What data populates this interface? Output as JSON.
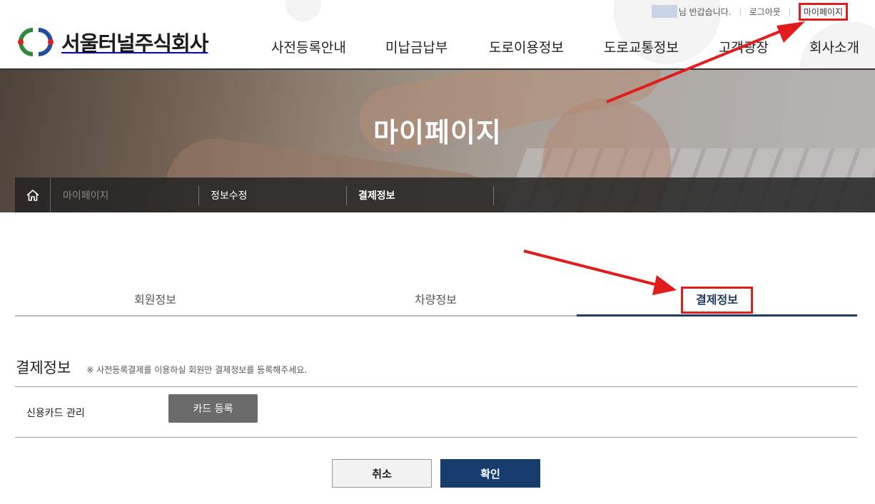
{
  "util": {
    "greeting": "님 반갑습니다.",
    "logout": "로그아웃",
    "mypage": "마이페이지"
  },
  "logo": {
    "text": "서울터널주식회사"
  },
  "gnb": [
    "사전등록안내",
    "미납금납부",
    "도로이용정보",
    "도로교통정보",
    "고객광장",
    "회사소개"
  ],
  "hero": {
    "title": "마이페이지"
  },
  "breadcrumb": {
    "items": [
      "마이페이지",
      "정보수정",
      "결제정보"
    ]
  },
  "tabs": [
    "회원정보",
    "차량정보",
    "결제정보"
  ],
  "section": {
    "title": "결제정보",
    "note": "※ 사전등록결제를 이용하실 회원만 결제정보를 등록해주세요.",
    "card_label": "신용카드 관리",
    "card_button": "카드 등록"
  },
  "buttons": {
    "cancel": "취소",
    "confirm": "확인"
  },
  "colors": {
    "accent": "#173d6e",
    "highlight": "#e21b1b"
  }
}
